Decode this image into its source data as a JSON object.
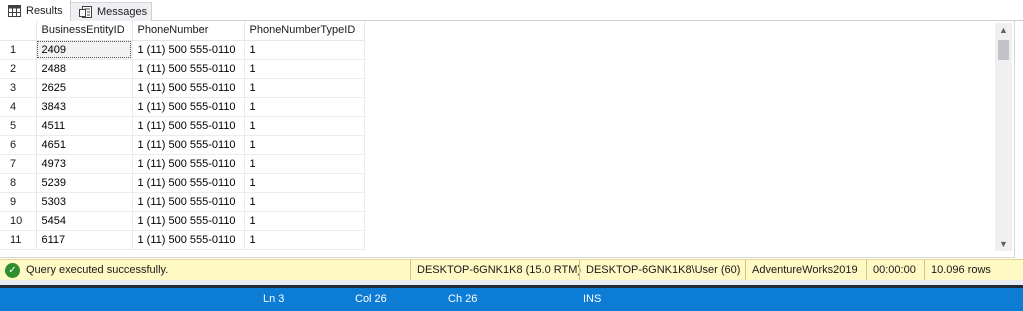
{
  "tabs": [
    {
      "label": "Results",
      "icon": "grid-results-icon",
      "active": true
    },
    {
      "label": "Messages",
      "icon": "messages-icon",
      "active": false
    }
  ],
  "grid": {
    "columns": [
      "BusinessEntityID",
      "PhoneNumber",
      "PhoneNumberTypeID"
    ],
    "rows": [
      {
        "num": "1",
        "cells": [
          "2409",
          "1 (11) 500 555-0110",
          "1"
        ]
      },
      {
        "num": "2",
        "cells": [
          "2488",
          "1 (11) 500 555-0110",
          "1"
        ]
      },
      {
        "num": "3",
        "cells": [
          "2625",
          "1 (11) 500 555-0110",
          "1"
        ]
      },
      {
        "num": "4",
        "cells": [
          "3843",
          "1 (11) 500 555-0110",
          "1"
        ]
      },
      {
        "num": "5",
        "cells": [
          "4511",
          "1 (11) 500 555-0110",
          "1"
        ]
      },
      {
        "num": "6",
        "cells": [
          "4651",
          "1 (11) 500 555-0110",
          "1"
        ]
      },
      {
        "num": "7",
        "cells": [
          "4973",
          "1 (11) 500 555-0110",
          "1"
        ]
      },
      {
        "num": "8",
        "cells": [
          "5239",
          "1 (11) 500 555-0110",
          "1"
        ]
      },
      {
        "num": "9",
        "cells": [
          "5303",
          "1 (11) 500 555-0110",
          "1"
        ]
      },
      {
        "num": "10",
        "cells": [
          "5454",
          "1 (11) 500 555-0110",
          "1"
        ]
      },
      {
        "num": "11",
        "cells": [
          "6117",
          "1 (11) 500 555-0110",
          "1"
        ]
      }
    ]
  },
  "status": {
    "message": "Query executed successfully.",
    "server": "DESKTOP-6GNK1K8 (15.0 RTM)",
    "user": "DESKTOP-6GNK1K8\\User (60)",
    "database": "AdventureWorks2019",
    "elapsed": "00:00:00",
    "rows": "10.096 rows",
    "colors": {
      "background": "#fff9c4",
      "ok": "#2f8f2f"
    }
  },
  "editor": {
    "line": "Ln 3",
    "column": "Col 26",
    "char": "Ch 26",
    "mode": "INS",
    "colors": {
      "background": "#0d7cd5"
    }
  }
}
